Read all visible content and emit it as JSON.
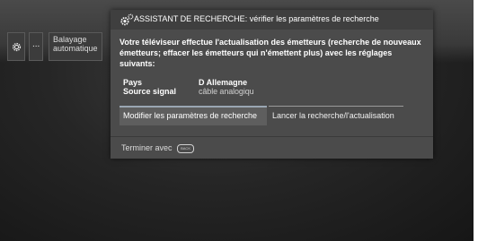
{
  "menu": {
    "dots_label": "...",
    "sweep_label": "Balayage automatique"
  },
  "dialog": {
    "title": "ASSISTANT DE RECHERCHE: vérifier les paramètres de recherche",
    "message": "Votre téléviseur effectue l'actualisation des émetteurs (recherche de nouveaux émetteurs; effacer les émetteurs qui n'émettent plus) avec les réglages suivants:",
    "settings": [
      {
        "label": "Pays",
        "value": "D Allemagne"
      },
      {
        "label": "Source signal",
        "value": "câble analogiqu"
      }
    ],
    "buttons": {
      "modify": "Modifier les paramètres de recherche",
      "launch": "Lancer la recherche/l'actualisation"
    },
    "footer": {
      "text": "Terminer avec",
      "key": "BACK"
    }
  }
}
